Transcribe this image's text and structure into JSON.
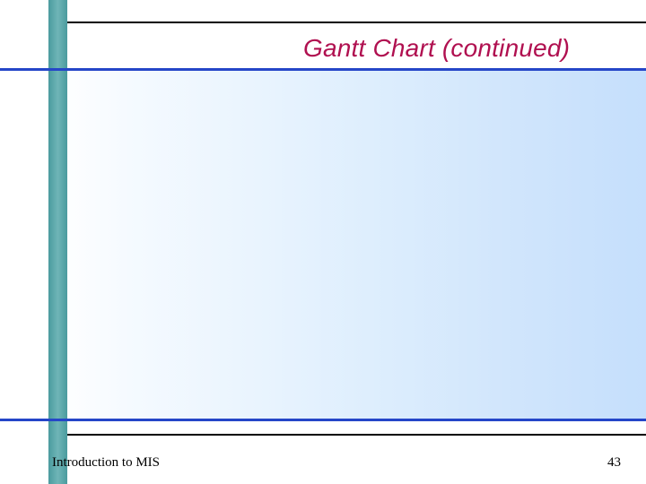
{
  "slide": {
    "title": "Gantt Chart (continued)"
  },
  "footer": {
    "left": "Introduction to MIS",
    "page_number": "43"
  }
}
